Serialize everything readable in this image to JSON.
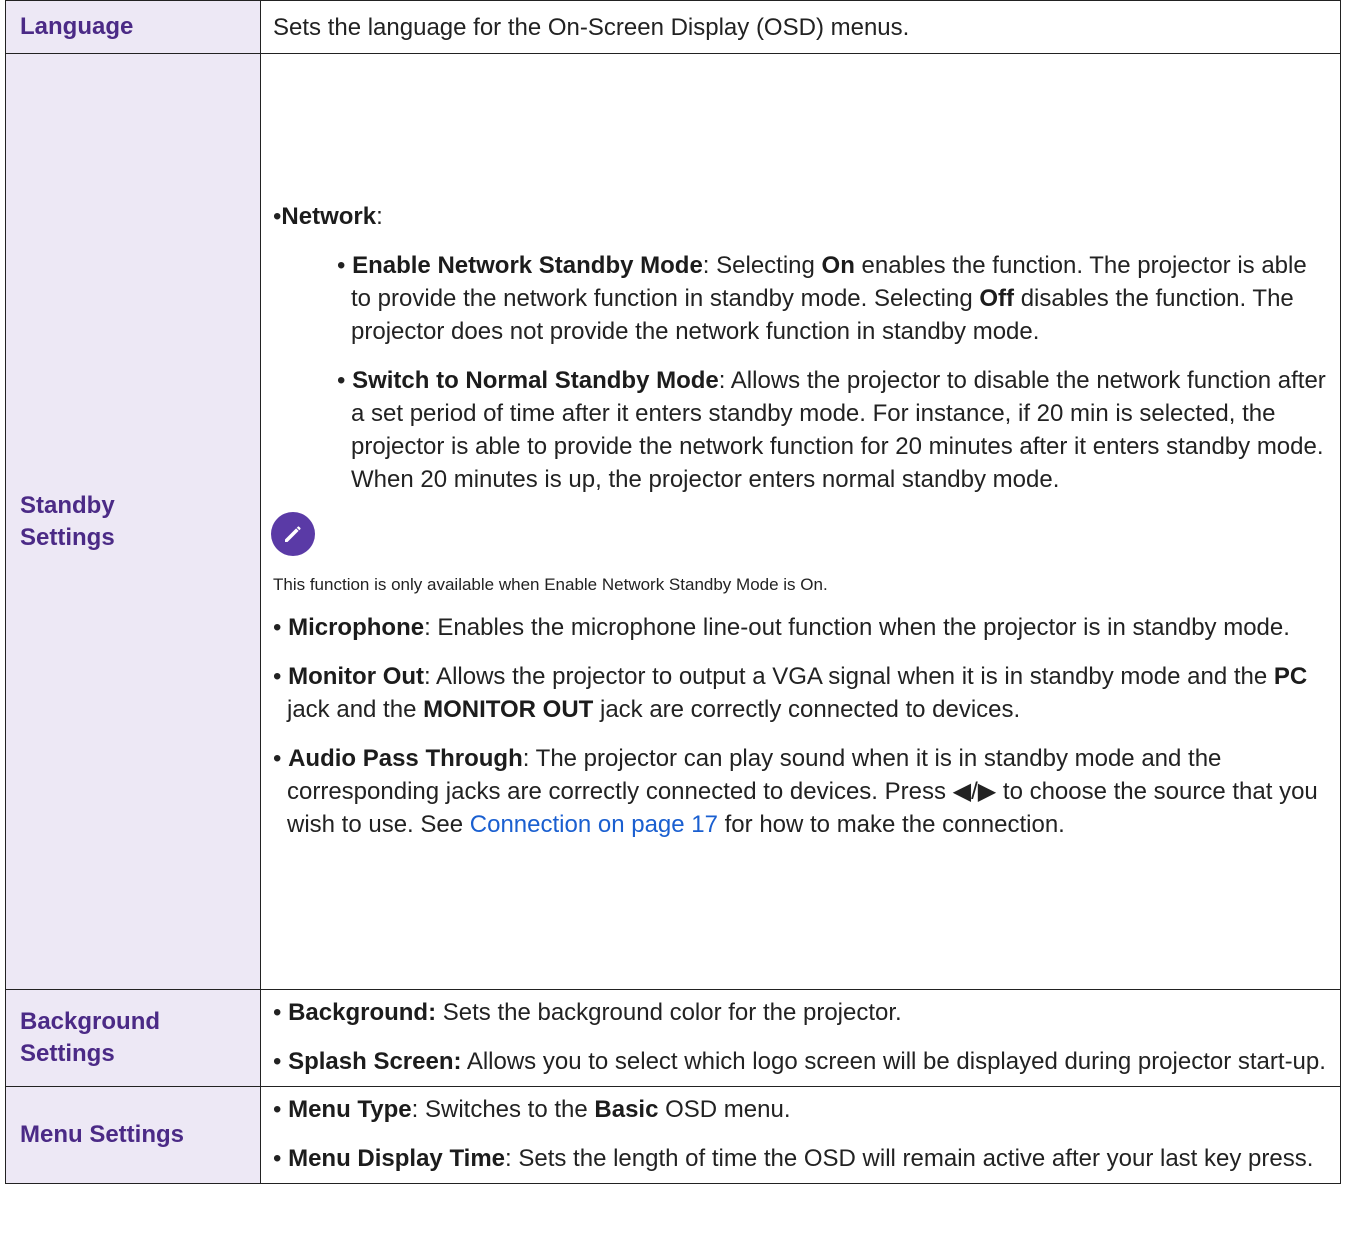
{
  "rows": {
    "language": {
      "label": "Language",
      "text": "Sets the language for the On-Screen Display (OSD) menus."
    },
    "standby": {
      "label_line1": "Standby",
      "label_line2": "Settings",
      "network_title": "Network",
      "enable_title": "Enable Network Standby Mode",
      "enable_t1": ": Selecting ",
      "enable_on": "On",
      "enable_t2": " enables the function. The projector is able to provide the network function in standby mode. Selecting ",
      "enable_off": "Off",
      "enable_t3": " disables the function. The projector does not provide the network function in standby mode.",
      "switch_title": "Switch to Normal Standby Mode",
      "switch_text": ": Allows the projector to disable the network function after a set period of time after it enters standby mode. For instance, if 20 min is selected, the projector is able to provide the network function for 20 minutes after it enters standby mode. When 20 minutes is up, the projector enters normal standby mode.",
      "note_icon": "pencil-note-icon",
      "note_text": "This function is only available when Enable Network Standby Mode is On.",
      "mic_title": "Microphone",
      "mic_text": ": Enables the microphone line-out function when the projector is in standby mode.",
      "monitor_title": "Monitor Out",
      "monitor_t1": ": Allows the projector to output a VGA signal when it is in standby mode and the ",
      "monitor_pc": "PC",
      "monitor_t2": " jack and the ",
      "monitor_out": "MONITOR OUT",
      "monitor_t3": " jack are correctly connected to devices.",
      "audio_title": "Audio Pass Through",
      "audio_t1": ": The projector can play sound when it is in standby mode and the corresponding jacks are correctly connected to devices. Press ◀/▶ to choose the source that you wish to use. See ",
      "audio_link": "Connection on page 17",
      "audio_t2": " for how to make the connection."
    },
    "background": {
      "label_line1": "Background",
      "label_line2": "Settings",
      "bg_title": "Background:",
      "bg_text": " Sets the background color for the projector.",
      "splash_title": "Splash Screen:",
      "splash_text": " Allows you to select which logo screen will be displayed during projector start-up."
    },
    "menu": {
      "label": "Menu Settings",
      "type_title": "Menu Type",
      "type_t1": ": Switches to the ",
      "type_basic": "Basic",
      "type_t2": " OSD menu.",
      "time_title": "Menu Display Time",
      "time_text": ": Sets the length of time the OSD will remain active after your last key press."
    }
  },
  "colors": {
    "label_bg": "#ede8f5",
    "label_text": "#4b2a86",
    "link": "#1a5fd0",
    "note_icon_bg": "#5a3aa6"
  },
  "bullet": "•"
}
